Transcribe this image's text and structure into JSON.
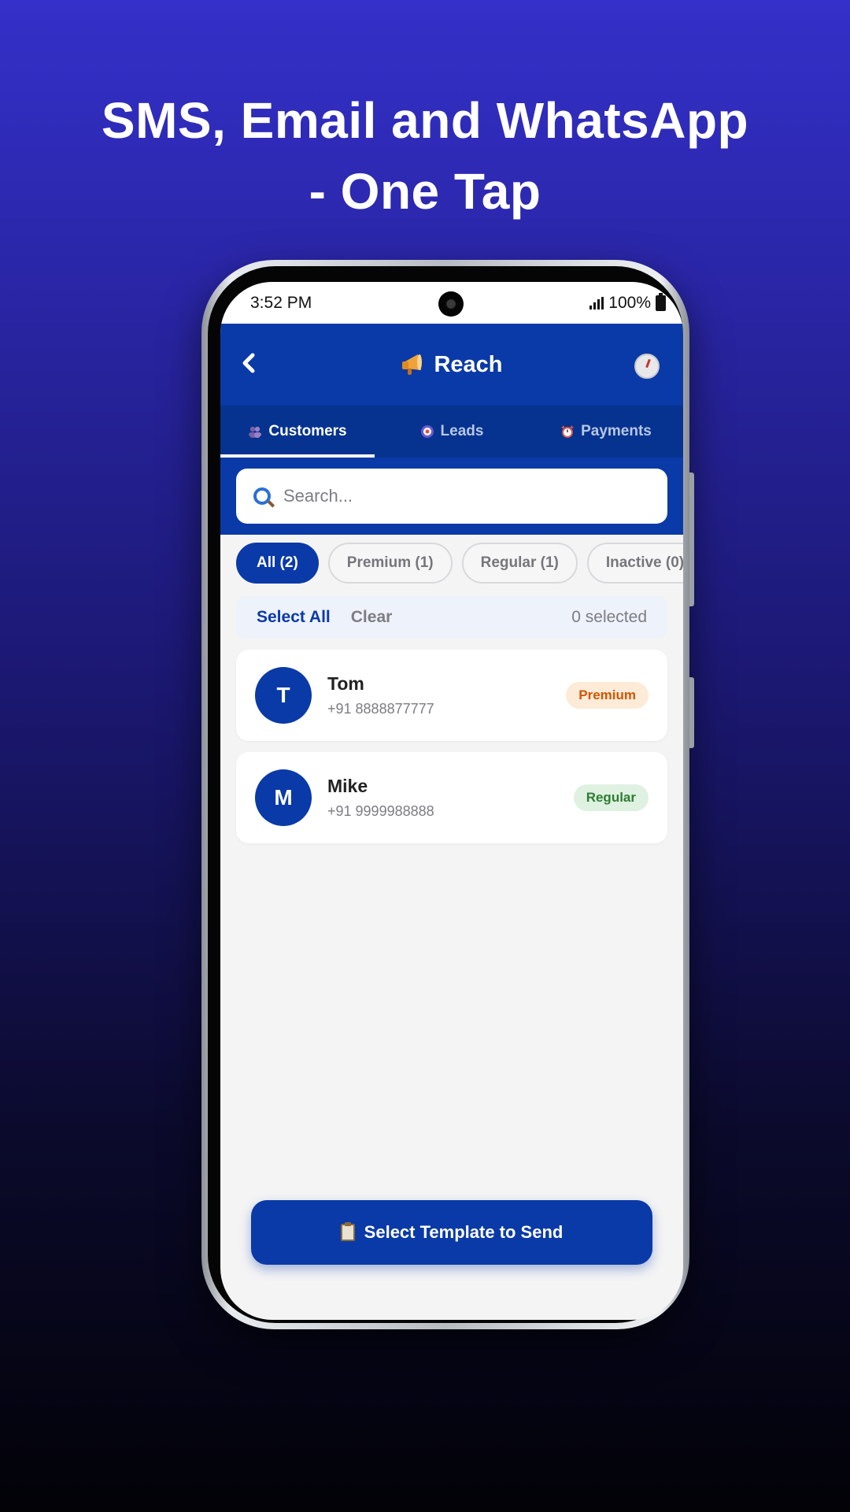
{
  "headline": {
    "line1": "SMS, Email and WhatsApp",
    "line2": "- One Tap"
  },
  "statusbar": {
    "time": "3:52 PM",
    "battery": "100%"
  },
  "appbar": {
    "back_icon": "chevron-left-icon",
    "title": "Reach",
    "title_icon": "megaphone-icon",
    "history_icon": "clock-icon"
  },
  "tabs": [
    {
      "label": "Customers",
      "icon": "people-icon",
      "active": true
    },
    {
      "label": "Leads",
      "icon": "target-icon",
      "active": false
    },
    {
      "label": "Payments",
      "icon": "alarm-clock-icon",
      "active": false
    }
  ],
  "search": {
    "placeholder": "Search..."
  },
  "filters": [
    {
      "label": "All (2)",
      "active": true
    },
    {
      "label": "Premium (1)",
      "active": false
    },
    {
      "label": "Regular (1)",
      "active": false
    },
    {
      "label": "Inactive (0)",
      "active": false
    }
  ],
  "selection": {
    "select_all": "Select All",
    "clear": "Clear",
    "count": "0 selected"
  },
  "customers": [
    {
      "initial": "T",
      "name": "Tom",
      "phone": "+91 8888877777",
      "tier": "Premium"
    },
    {
      "initial": "M",
      "name": "Mike",
      "phone": "+91 9999988888",
      "tier": "Regular"
    }
  ],
  "send_button": {
    "label": "Select Template to Send",
    "icon": "clipboard-icon"
  },
  "colors": {
    "brand": "#0a3aa7",
    "premium": "#d35400",
    "regular": "#2e7d32"
  }
}
